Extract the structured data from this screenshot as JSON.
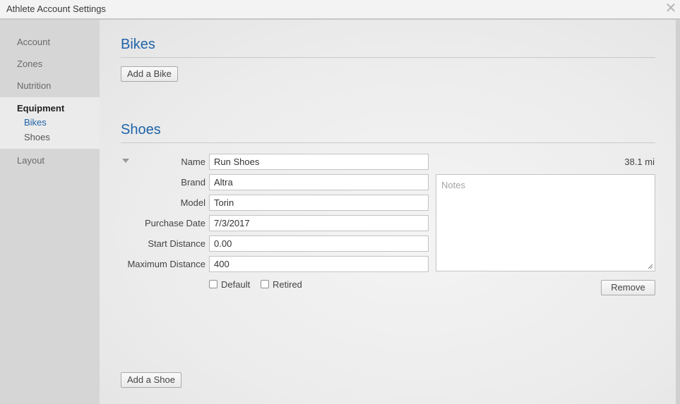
{
  "window": {
    "title": "Athlete Account Settings"
  },
  "sidebar": {
    "items": [
      "Account",
      "Zones",
      "Nutrition"
    ],
    "equipment": {
      "label": "Equipment",
      "subitems": [
        "Bikes",
        "Shoes"
      ],
      "selected": "Bikes"
    },
    "layout_label": "Layout"
  },
  "bikes": {
    "title": "Bikes",
    "add_label": "Add a Bike"
  },
  "shoes": {
    "title": "Shoes",
    "add_label": "Add a Shoe",
    "entry": {
      "distance": "38.1 mi",
      "fields": {
        "name": {
          "label": "Name",
          "value": "Run Shoes"
        },
        "brand": {
          "label": "Brand",
          "value": "Altra"
        },
        "model": {
          "label": "Model",
          "value": "Torin"
        },
        "date": {
          "label": "Purchase Date",
          "value": "7/3/2017"
        },
        "start": {
          "label": "Start Distance",
          "value": "0.00"
        },
        "max": {
          "label": "Maximum Distance",
          "value": "400"
        }
      },
      "notes_placeholder": "Notes",
      "default_label": "Default",
      "retired_label": "Retired",
      "remove_label": "Remove"
    }
  },
  "colors": {
    "accent": "#1e63a8",
    "sidebar_bg": "#d6d6d6",
    "sidebar_group_bg": "#ebebeb"
  }
}
